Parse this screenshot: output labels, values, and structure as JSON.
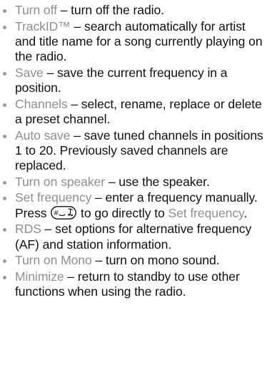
{
  "items": [
    {
      "term": "Turn off",
      "desc": " – turn off the radio."
    },
    {
      "term": "TrackID™",
      "desc": " – search automatically for artist and title name for a song currently playing on the radio."
    },
    {
      "term": "Save",
      "desc": " – save the current frequency in a position."
    },
    {
      "term": "Channels",
      "desc": " – select, rename, replace or delete a preset channel."
    },
    {
      "term": "Auto save",
      "desc": " – save tuned channels in positions 1 to 20. Previously saved channels are replaced."
    },
    {
      "term": "Turn on speaker",
      "desc": " – use the speaker."
    },
    {
      "term": "Set frequency",
      "desc_before": " – enter a frequency manually. Press ",
      "key_icon": "hash-key-icon",
      "desc_middle": " to go directly to ",
      "term_inline": "Set frequency",
      "desc_after": "."
    },
    {
      "term": "RDS",
      "desc": " – set options for alternative frequency (AF) and station information."
    },
    {
      "term": "Turn on Mono",
      "desc": " – turn on mono sound."
    },
    {
      "term": "Minimize",
      "desc": " – return to standby to use other functions when using the radio."
    }
  ]
}
